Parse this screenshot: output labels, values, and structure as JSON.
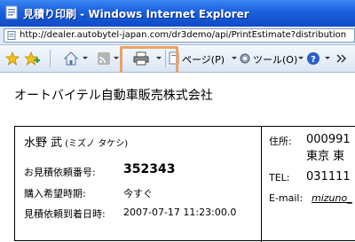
{
  "window": {
    "title": "見積り印刷 - Windows Internet Explorer"
  },
  "address_bar": {
    "url": "http://dealer.autobytel-japan.com/dr3demo/api/PrintEstimate?distribution"
  },
  "toolbar": {
    "page_label": "ページ(P)",
    "tools_label": "ツール(O)"
  },
  "document": {
    "company_name": "オートバイテル自動車販売株式会社",
    "customer": {
      "name": "水野 武",
      "kana": "(ミズノ タケシ)"
    },
    "fields": [
      {
        "label": "お見積依頼番号:",
        "value": "352343"
      },
      {
        "label": "購入希望時期:",
        "value": "今すぐ"
      },
      {
        "label": "見積依頼到着日時:",
        "value": "2007-07-17 11:23:00.0"
      }
    ],
    "contact": {
      "address_label": "住所:",
      "address_line1": "000991",
      "address_line2": "東京 東",
      "tel_label": "TEL:",
      "tel_value": "031111",
      "email_label": "E-mail:",
      "email_value": "mizuno_"
    }
  }
}
